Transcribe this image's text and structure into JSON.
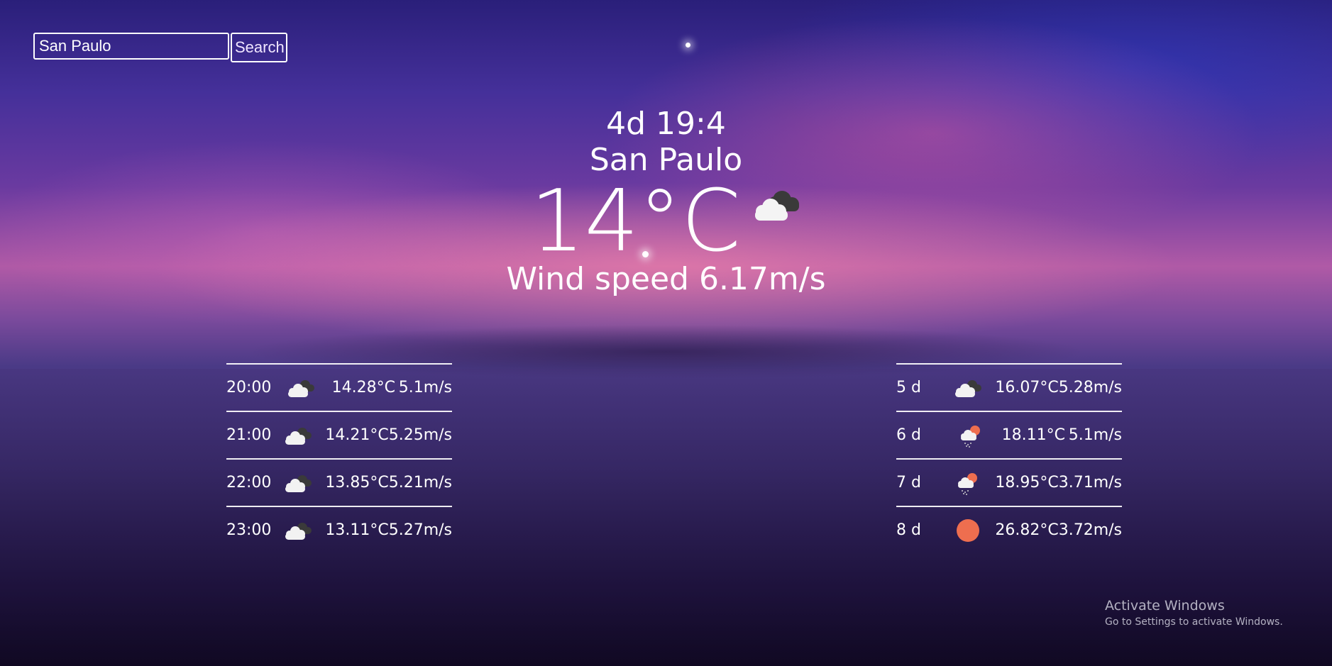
{
  "search": {
    "value": "San Paulo",
    "button_label": "Search"
  },
  "current": {
    "date": "4d 19:4",
    "city": "San Paulo",
    "temperature": "14°C",
    "wind": "Wind speed 6.17m/s",
    "icon": "dark-cloud-icon"
  },
  "hourly": [
    {
      "time": "20:00",
      "icon": "dark-cloud-icon",
      "temp": "14.28°C",
      "wind": "5.1m/s"
    },
    {
      "time": "21:00",
      "icon": "dark-cloud-icon",
      "temp": "14.21°C",
      "wind": "5.25m/s"
    },
    {
      "time": "22:00",
      "icon": "dark-cloud-icon",
      "temp": "13.85°C",
      "wind": "5.21m/s"
    },
    {
      "time": "23:00",
      "icon": "dark-cloud-icon",
      "temp": "13.11°C",
      "wind": "5.27m/s"
    }
  ],
  "daily": [
    {
      "day": "5 d",
      "icon": "dark-cloud-icon",
      "temp": "16.07°C",
      "wind": "5.28m/s"
    },
    {
      "day": "6 d",
      "icon": "sun-cloud-rain-icon",
      "temp": "18.11°C",
      "wind": "5.1m/s"
    },
    {
      "day": "7 d",
      "icon": "sun-cloud-rain-icon",
      "temp": "18.95°C",
      "wind": "3.71m/s"
    },
    {
      "day": "8 d",
      "icon": "sun-icon",
      "temp": "26.82°C",
      "wind": "3.72m/s"
    }
  ],
  "watermark": {
    "title": "Activate Windows",
    "subtitle": "Go to Settings to activate Windows."
  },
  "colors": {
    "sun": "#ee6e4f",
    "cloud_light": "#f2f2f2",
    "cloud_dark": "#3a3a3a"
  }
}
